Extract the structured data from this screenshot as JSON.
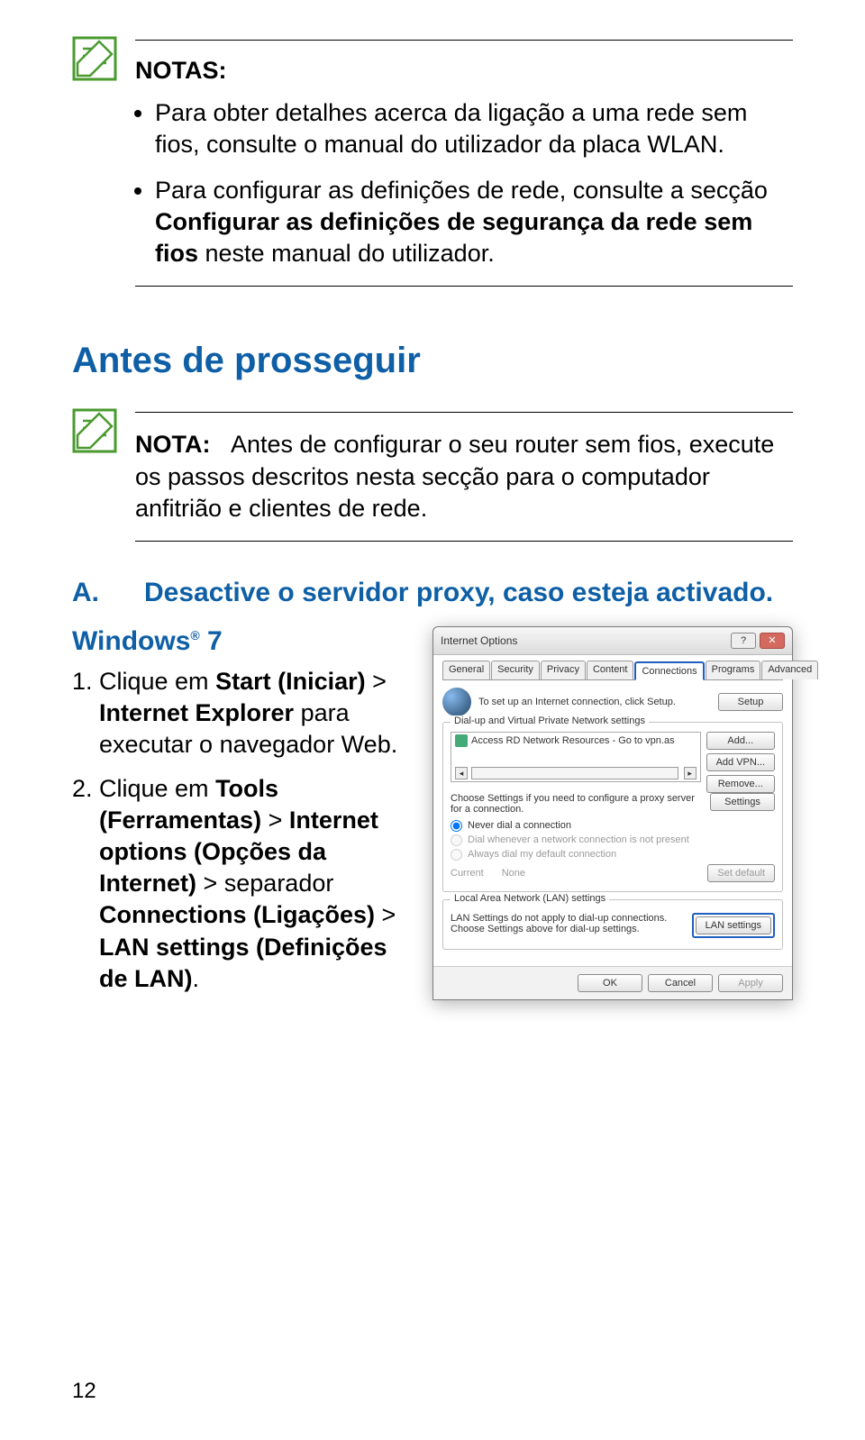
{
  "notas": {
    "title": "NOTAS:",
    "bullet1": "Para obter detalhes acerca da ligação a uma rede sem fios, consulte o manual do utilizador da placa WLAN.",
    "bullet2_pre": "Para configurar as definições de rede, consulte a secção ",
    "bullet2_bold": "Configurar as definições de segurança da rede sem fios",
    "bullet2_post": " neste manual do utilizador."
  },
  "section_heading": "Antes de prosseguir",
  "nota2": {
    "label": "NOTA:",
    "text": "Antes de configurar o seu router sem fios, execute os passos descritos nesta secção para o computador anfitrião e clientes de rede."
  },
  "sectionA": {
    "letter": "A.",
    "title": "Desactive o servidor proxy, caso esteja activado."
  },
  "os_heading_pre": "Windows",
  "os_heading_sup": "®",
  "os_heading_post": " 7",
  "steps": {
    "s1_pre": "Clique em ",
    "s1_b1": "Start (Iniciar)",
    "s1_mid": " > ",
    "s1_b2": "Internet Explorer",
    "s1_post": " para executar o navegador Web.",
    "s2_pre": "Clique em ",
    "s2_b1": "Tools (Ferramentas)",
    "s2_m1": " > ",
    "s2_b2": "Internet options (Opções da Internet)",
    "s2_m2": " > separador ",
    "s2_b3": "Connections (Ligações)",
    "s2_m3": " > ",
    "s2_b4": "LAN settings (Definições de LAN)",
    "s2_post": "."
  },
  "dialog": {
    "title": "Internet Options",
    "help": "?",
    "close": "✕",
    "tabs": {
      "general": "General",
      "security": "Security",
      "privacy": "Privacy",
      "content": "Content",
      "connections": "Connections",
      "programs": "Programs",
      "advanced": "Advanced"
    },
    "setup_text": "To set up an Internet connection, click Setup.",
    "btn_setup": "Setup",
    "grp1_title": "Dial-up and Virtual Private Network settings",
    "list_item": "Access RD Network Resources - Go to vpn.as",
    "btn_add": "Add...",
    "btn_addvpn": "Add VPN...",
    "btn_remove": "Remove...",
    "proxy_text": "Choose Settings if you need to configure a proxy server for a connection.",
    "btn_settings": "Settings",
    "radio_never": "Never dial a connection",
    "radio_whenever": "Dial whenever a network connection is not present",
    "radio_always": "Always dial my default connection",
    "current_label": "Current",
    "current_value": "None",
    "btn_setdefault": "Set default",
    "grp2_title": "Local Area Network (LAN) settings",
    "lan_text": "LAN Settings do not apply to dial-up connections. Choose Settings above for dial-up settings.",
    "btn_lan": "LAN settings",
    "btn_ok": "OK",
    "btn_cancel": "Cancel",
    "btn_apply": "Apply"
  },
  "page_number": "12"
}
